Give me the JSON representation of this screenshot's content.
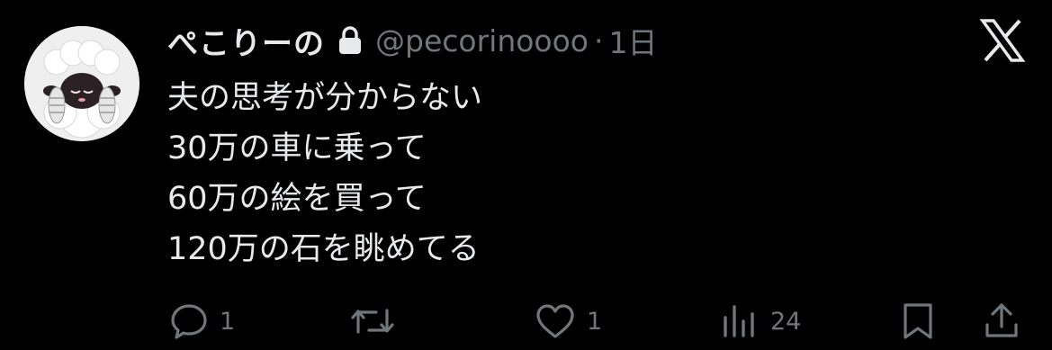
{
  "user": {
    "display_name": "ぺこりーの",
    "handle": "@pecorinoooo",
    "separator": "·",
    "time": "1日",
    "protected_icon": "lock-icon",
    "avatar_icon": "sheep-avatar"
  },
  "brand": {
    "logo": "x-logo-icon"
  },
  "tweet": {
    "lines": [
      "夫の思考が分からない",
      "30万の車に乗って",
      "60万の絵を買って",
      "120万の石を眺めてる"
    ]
  },
  "actions": {
    "reply": {
      "icon": "reply-icon",
      "count": "1"
    },
    "retweet": {
      "icon": "retweet-icon",
      "count": ""
    },
    "like": {
      "icon": "heart-icon",
      "count": "1"
    },
    "views": {
      "icon": "views-icon",
      "count": "24"
    },
    "bookmark": {
      "icon": "bookmark-icon"
    },
    "share": {
      "icon": "share-icon"
    }
  },
  "colors": {
    "background": "#000000",
    "primary_text": "#e7e9ea",
    "secondary_text": "#71767b"
  }
}
